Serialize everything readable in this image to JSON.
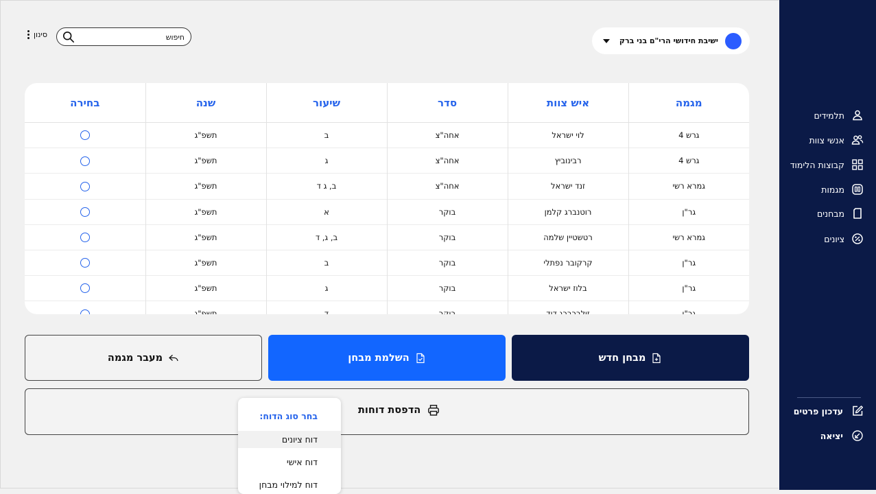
{
  "sidebar": {
    "nav": [
      {
        "label": "תלמידים",
        "icon": "person-icon"
      },
      {
        "label": "אנשי צוות",
        "icon": "people-icon"
      },
      {
        "label": "קבוצות הלימוד",
        "icon": "grid-icon"
      },
      {
        "label": "מגמות",
        "icon": "tracks-icon"
      },
      {
        "label": "מבחנים",
        "icon": "document-icon"
      },
      {
        "label": "ציונים",
        "icon": "percent-icon"
      }
    ],
    "update_details": "עדכון פרטים",
    "logout": "יציאה"
  },
  "header": {
    "yeshiva_name": "ישיבת חידושי הרי\"ם בני ברק",
    "search_value": "חיפוש",
    "filter_label": "סינון"
  },
  "table": {
    "columns": [
      "מגמה",
      "איש צוות",
      "סדר",
      "שיעור",
      "שנה",
      "בחירה"
    ],
    "rows": [
      [
        "גרש 4",
        "לוי ישראל",
        "אחה\"צ",
        "ב",
        "תשפ\"ג"
      ],
      [
        "גרש 4",
        "רבינוביץ",
        "אחה\"צ",
        "ג",
        "תשפ\"ג"
      ],
      [
        "גמרא רשי",
        "זנד ישראל",
        "אחה\"צ",
        "ב, ג ד",
        "תשפ\"ג"
      ],
      [
        "גר\"ן",
        "רוטנברג קלמן",
        "בוקר",
        "א",
        "תשפ\"ג"
      ],
      [
        "גמרא רשי",
        "רטשטיין שלמה",
        "בוקר",
        "ב, ג, ד",
        "תשפ\"ג"
      ],
      [
        "גר\"ן",
        "קרקובר נפתלי",
        "בוקר",
        "ב",
        "תשפ\"ג"
      ],
      [
        "גר\"ן",
        "בלוז ישראל",
        "בוקר",
        "ג",
        "תשפ\"ג"
      ],
      [
        "גר\"ן",
        "זילברברג דוד",
        "בוקר",
        "ד",
        "תשפ\"ג"
      ]
    ]
  },
  "actions": {
    "new_exam": "מבחן חדש",
    "complete_exam": "השלמת מבחן",
    "transfer_track": "מעבר מגמה",
    "print_reports": "הדפסת דוחות"
  },
  "report_dropdown": {
    "title": "בחר סוג הדוח:",
    "items": [
      "דוח ציונים",
      "דוח אישי",
      "דוח למילוי מבחן"
    ],
    "selected_index": 0
  },
  "colors": {
    "sidebar": "#0b1a47",
    "accent": "#2563eb",
    "primary_button": "#1266ff"
  }
}
